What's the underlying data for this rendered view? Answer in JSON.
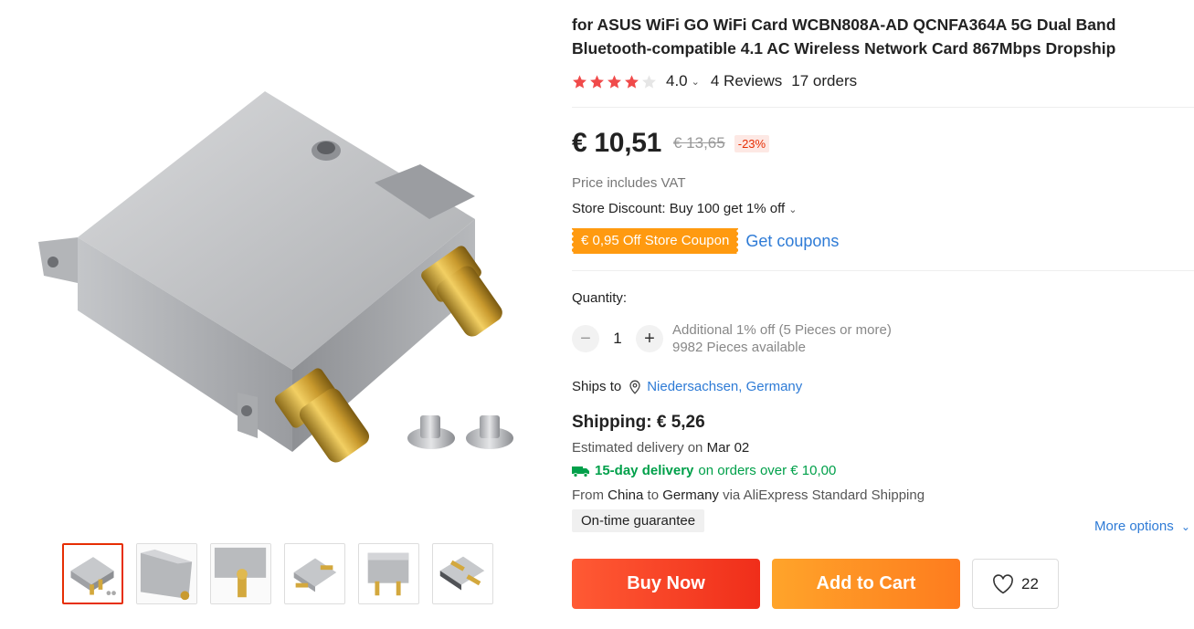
{
  "product": {
    "title": "for ASUS WiFi GO WiFi Card WCBN808A-AD QCNFA364A 5G Dual Band Bluetooth-compatible 4.1 AC Wireless Network Card 867Mbps Dropship",
    "stars": 4.0,
    "rating": "4.0",
    "reviews": "4 Reviews",
    "orders": "17 orders"
  },
  "price": {
    "current": "€ 10,51",
    "original": "€ 13,65",
    "discount": "-23%",
    "vat_note": "Price includes VAT",
    "store_discount": "Store Discount: Buy 100 get 1% off"
  },
  "coupon": {
    "label": "€ 0,95 Off Store Coupon",
    "get_coupons": "Get coupons"
  },
  "quantity": {
    "label": "Quantity:",
    "minus": "−",
    "plus": "+",
    "value": "1",
    "note_discount": "Additional 1% off (5 Pieces or more)",
    "note_available": "9982 Pieces available"
  },
  "shipping": {
    "ships_to_label": "Ships to",
    "ships_to_location": "Niedersachsen, Germany",
    "cost": "Shipping: € 5,26",
    "estimated_prefix": "Estimated delivery on",
    "estimated_date": "Mar 02",
    "fast_delivery": "15-day delivery",
    "fast_condition": "on orders over € 10,00",
    "from_prefix": "From",
    "from_country": "China",
    "to_word": "to",
    "to_country": "Germany",
    "via": "via AliExpress Standard Shipping",
    "guarantee": "On-time guarantee",
    "more_options": "More options"
  },
  "actions": {
    "buy_now": "Buy Now",
    "add_to_cart": "Add to Cart",
    "wishlist_count": "22"
  },
  "gallery": {
    "thumbnail_count": 6,
    "active_index": 0
  },
  "colors": {
    "star": "#f04a4a",
    "price_accent": "#e62e04",
    "link": "#2e7bd6",
    "coupon": "#ff9a10",
    "fast_delivery": "#00a04a",
    "buy_now": "#f23b22",
    "add_to_cart": "#fe8f21"
  }
}
